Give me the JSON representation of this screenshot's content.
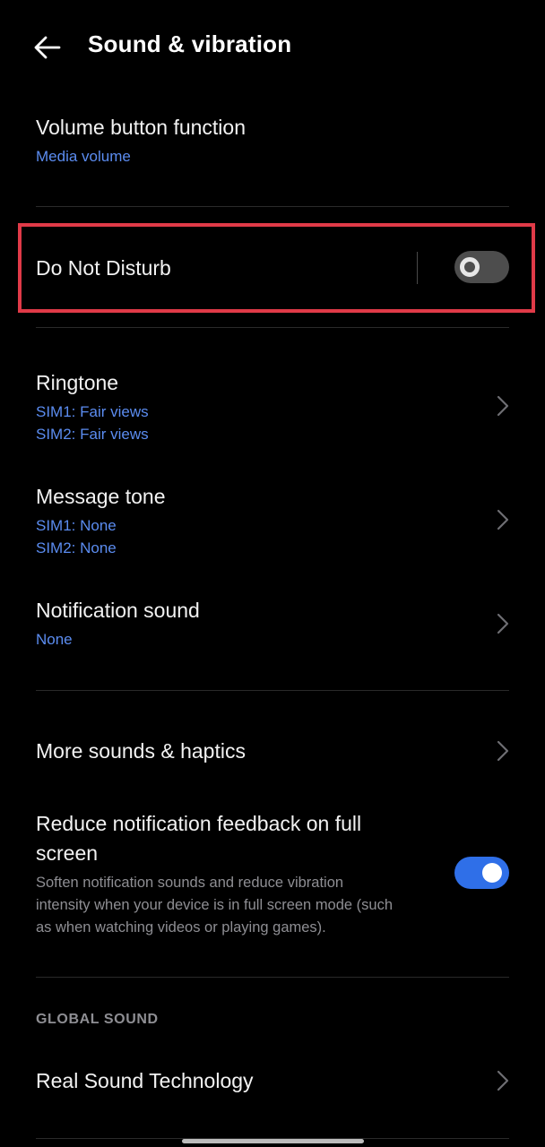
{
  "header": {
    "title": "Sound & vibration",
    "back_icon": "arrow-left-icon"
  },
  "volume": {
    "title": "Volume button function",
    "value": "Media volume"
  },
  "dnd": {
    "title": "Do Not Disturb",
    "enabled": false
  },
  "ringtone": {
    "title": "Ringtone",
    "sim1": "SIM1: Fair views",
    "sim2": "SIM2: Fair views"
  },
  "message_tone": {
    "title": "Message tone",
    "sim1": "SIM1: None",
    "sim2": "SIM2: None"
  },
  "notification_sound": {
    "title": "Notification sound",
    "value": "None"
  },
  "more_sounds": {
    "title": "More sounds & haptics"
  },
  "reduce_feedback": {
    "title_line1": "Reduce notification feedback on full",
    "title_line2": "screen",
    "desc_line1": "Soften notification sounds and reduce vibration",
    "desc_line2": "intensity when your device is in full screen mode (such",
    "desc_line3": "as when watching videos or playing games).",
    "enabled": true
  },
  "global_sound": {
    "section_label": "GLOBAL SOUND",
    "real_sound_title": "Real Sound Technology"
  },
  "colors": {
    "accent": "#2f6fe8",
    "link": "#5b8cf0",
    "highlight": "#e03a48"
  }
}
